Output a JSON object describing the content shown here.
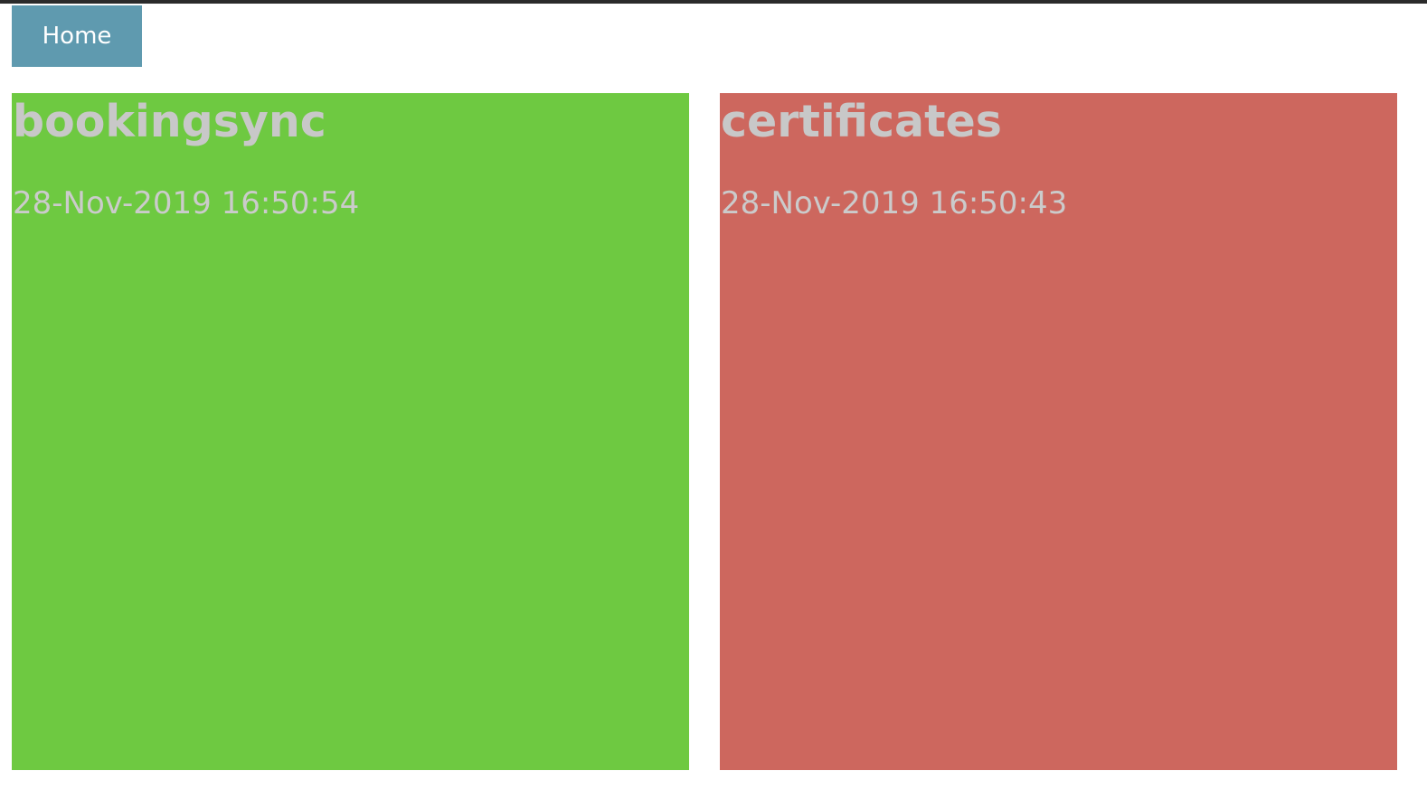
{
  "nav": {
    "home_label": "Home",
    "home_color": "#5f9aaf"
  },
  "tiles": [
    {
      "name": "bookingsync",
      "timestamp": "28-Nov-2019 16:50:54",
      "status": "ok",
      "color": "#6ec941"
    },
    {
      "name": "certificates",
      "timestamp": "28-Nov-2019 16:50:43",
      "status": "error",
      "color": "#cd675e"
    }
  ],
  "colors": {
    "text": "#c8c8c8",
    "top_border": "#2b2b2b"
  }
}
